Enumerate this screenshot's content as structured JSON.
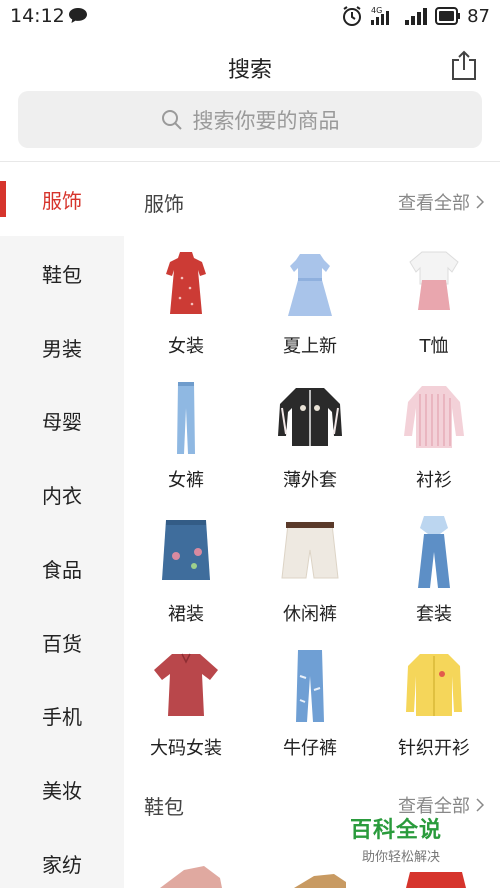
{
  "status_bar": {
    "time": "14:12",
    "network": "4G",
    "battery": "87"
  },
  "header": {
    "title": "搜索"
  },
  "search": {
    "placeholder": "搜索你要的商品"
  },
  "sidebar": {
    "items": [
      {
        "label": "服饰",
        "active": true
      },
      {
        "label": "鞋包"
      },
      {
        "label": "男装"
      },
      {
        "label": "母婴"
      },
      {
        "label": "内衣"
      },
      {
        "label": "食品"
      },
      {
        "label": "百货"
      },
      {
        "label": "手机"
      },
      {
        "label": "美妆"
      },
      {
        "label": "家纺"
      }
    ]
  },
  "sections": [
    {
      "title": "服饰",
      "view_all": "查看全部",
      "items": [
        {
          "label": "女装"
        },
        {
          "label": "夏上新"
        },
        {
          "label": "T恤"
        },
        {
          "label": "女裤"
        },
        {
          "label": "薄外套"
        },
        {
          "label": "衬衫"
        },
        {
          "label": "裙装"
        },
        {
          "label": "休闲裤"
        },
        {
          "label": "套装"
        },
        {
          "label": "大码女装"
        },
        {
          "label": "牛仔裤"
        },
        {
          "label": "针织开衫"
        }
      ]
    },
    {
      "title": "鞋包",
      "view_all": "查看全部"
    }
  ],
  "watermark": {
    "logo": "百科全说",
    "sub": "助你轻松解决"
  },
  "colors": {
    "accent": "#d6342c",
    "sidebar_bg": "#f5f5f5",
    "search_bg": "#efefef"
  }
}
